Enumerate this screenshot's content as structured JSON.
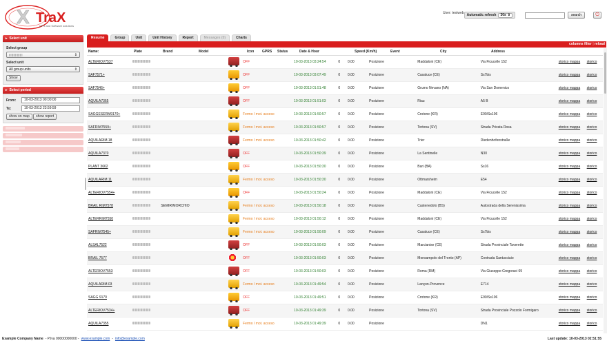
{
  "header": {
    "brand": "TraX",
    "tagline": "GPS and Software solutions",
    "user_label": "User: testweb",
    "auto_refresh_label": "Automatic refresh",
    "auto_refresh_value": "30s",
    "search_value": "",
    "search_button": "search"
  },
  "sidebar": {
    "select_unit_title": "Select unit",
    "select_group_label": "Select group",
    "select_unit_label": "Select unit",
    "unit_value": "All group units",
    "show_button": "Show",
    "select_period_title": "Select period",
    "from_label": "From:",
    "from_value": "10-03-2013 00:00:00",
    "to_label": "To:",
    "to_value": "10-03-2013 23:59:59",
    "show_on_map_button": "show on map",
    "show_report_button": "show report"
  },
  "tabs": [
    {
      "label": "Resume",
      "state": "active"
    },
    {
      "label": "Group",
      "state": "normal"
    },
    {
      "label": "Unit",
      "state": "normal"
    },
    {
      "label": "Unit History",
      "state": "normal"
    },
    {
      "label": "Report",
      "state": "normal"
    },
    {
      "label": "Messages (0)",
      "state": "disabled"
    },
    {
      "label": "Charts",
      "state": "normal"
    }
  ],
  "tab_bar": {
    "columns_filter": "columns filter",
    "reload": "reload"
  },
  "table": {
    "headers": [
      "Name:",
      "Plate",
      "Brand",
      "Model",
      "",
      "Icon",
      "GPRS",
      "Status",
      "Date & Hour",
      "",
      "Speed (Km/h)",
      "Event",
      "City",
      "Address",
      "",
      ""
    ],
    "link1": "storico mappa",
    "link2": "storico",
    "rows": [
      {
        "name": "ALTERIOV7537",
        "brand": "",
        "icon": "truck",
        "status": "OFF",
        "dt": "10-03-2013 03:24:54",
        "z1": "0",
        "speed": "0.00",
        "event": "Posizione",
        "city": "Maddaloni (CE)",
        "addr": "Via Ficucelle 152"
      },
      {
        "name": "SAF7571+",
        "brand": "",
        "icon": "van",
        "status": "OFF",
        "dt": "10-03-2013 03:07:49",
        "z1": "0",
        "speed": "0.00",
        "event": "Posizione",
        "city": "Casaluce (CE)",
        "addr": "Ss7bis"
      },
      {
        "name": "SAF7546+",
        "brand": "",
        "icon": "van",
        "status": "OFF",
        "dt": "10-03-2013 01:51:48",
        "z1": "0",
        "speed": "0.00",
        "event": "Posizione",
        "city": "Grumo Nevano (NA)",
        "addr": "Via San Domenico"
      },
      {
        "name": "AQUILA7365",
        "brand": "",
        "icon": "truck",
        "status": "OFF",
        "dt": "10-03-2013 01:51:03",
        "z1": "0",
        "speed": "0.00",
        "event": "Posizione",
        "city": "Riau",
        "addr": "A5 B"
      },
      {
        "name": "SAGGESERM9170+",
        "brand": "",
        "icon": "box",
        "status": "Fermo / mot. acceso",
        "dt": "10-03-2013 01:50:57",
        "z1": "0",
        "speed": "0.00",
        "event": "Posizione",
        "city": "Crotone (KR)",
        "addr": "E90/Ss106"
      },
      {
        "name": "SAFRIM7559+",
        "brand": "",
        "icon": "box",
        "status": "Fermo / mot. acceso",
        "dt": "10-03-2013 01:50:57",
        "z1": "0",
        "speed": "0.00",
        "event": "Posizione",
        "city": "Tortona (SV)",
        "addr": "Strada Privata Rosa"
      },
      {
        "name": "AQUILARIM.18",
        "brand": "",
        "icon": "truck",
        "status": "Fermo / mot. acceso",
        "dt": "10-03-2013 01:50:42",
        "z1": "0",
        "speed": "0.00",
        "event": "Posizione",
        "city": "Trier",
        "addr": "Diedenhofenstraße"
      },
      {
        "name": "AQUILA7370",
        "brand": "",
        "icon": "truck",
        "status": "OFF",
        "dt": "10-03-2013 01:50:39",
        "z1": "0",
        "speed": "0.00",
        "event": "Posizione",
        "city": "La Sentinelle",
        "addr": "N30"
      },
      {
        "name": "PLANT 3662",
        "brand": "",
        "icon": "van",
        "status": "OFF",
        "dt": "10-03-2013 01:50:30",
        "z1": "0",
        "speed": "0.00",
        "event": "Posizione",
        "city": "Bari (BA)",
        "addr": "Ss16"
      },
      {
        "name": "AQUILARIM.11",
        "brand": "",
        "icon": "box",
        "status": "Fermo / mot. acceso",
        "dt": "10-03-2013 01:50:30",
        "z1": "0",
        "speed": "0.00",
        "event": "Posizione",
        "city": "Ottmarsheim",
        "addr": "E54"
      },
      {
        "name": "ALTERIOV7554+",
        "brand": "",
        "icon": "van",
        "status": "OFF",
        "dt": "10-03-2013 01:50:24",
        "z1": "0",
        "speed": "0.00",
        "event": "Posizione",
        "city": "Maddaloni (CE)",
        "addr": "Via Ficucelle 152"
      },
      {
        "name": "BRAIL RIM7578",
        "brand": "SEMIRIMORCHIO",
        "icon": "box",
        "status": "Fermo / mot. acceso",
        "dt": "10-03-2013 01:50:18",
        "z1": "0",
        "speed": "0.00",
        "event": "Posizione",
        "city": "Castenedolo (BS)",
        "addr": "Autostrada della Serenissima"
      },
      {
        "name": "ALTERRIM7550",
        "brand": "",
        "icon": "box",
        "status": "Fermo / mot. acceso",
        "dt": "10-03-2013 01:50:12",
        "z1": "0",
        "speed": "0.00",
        "event": "Posizione",
        "city": "Maddaloni (CE)",
        "addr": "Via Ficucelle 152"
      },
      {
        "name": "SAFRIM7545+",
        "brand": "",
        "icon": "box",
        "status": "Fermo / mot. acceso",
        "dt": "10-03-2013 01:50:09",
        "z1": "0",
        "speed": "0.00",
        "event": "Posizione",
        "city": "Casaluce (CE)",
        "addr": "Ss7bis"
      },
      {
        "name": "ALSAL7522",
        "brand": "",
        "icon": "truck",
        "status": "OFF",
        "dt": "10-03-2013 01:50:03",
        "z1": "0",
        "speed": "0.00",
        "event": "Posizione",
        "city": "Marcianise (CE)",
        "addr": "Strada Provinciale Taverette"
      },
      {
        "name": "BRAIL 7577",
        "brand": "",
        "icon": "pin",
        "status": "OFF",
        "dt": "10-03-2013 01:50:03",
        "z1": "0",
        "speed": "0.00",
        "event": "Posizione",
        "city": "Monsampolo del Tronto (AP)",
        "addr": "Contrada Santucciaio"
      },
      {
        "name": "ALTERIOV7553",
        "brand": "",
        "icon": "truck",
        "status": "OFF",
        "dt": "10-03-2013 01:50:03",
        "z1": "0",
        "speed": "0.00",
        "event": "Posizione",
        "city": "Roma (RM)",
        "addr": "Via Giuseppe Gregoraci 69"
      },
      {
        "name": "AQUILARIM.03",
        "brand": "",
        "icon": "box",
        "status": "Fermo / mot. acceso",
        "dt": "10-03-2013 01:49:54",
        "z1": "0",
        "speed": "0.00",
        "event": "Posizione",
        "city": "Lançon-Provence",
        "addr": "E714"
      },
      {
        "name": "SAGG 9170",
        "brand": "",
        "icon": "van",
        "status": "OFF",
        "dt": "10-03-2013 01:49:51",
        "z1": "0",
        "speed": "0.00",
        "event": "Posizione",
        "city": "Crotone (KR)",
        "addr": "E90/Ss106"
      },
      {
        "name": "ALTERIOV7534+",
        "brand": "",
        "icon": "truck",
        "status": "OFF",
        "dt": "10-03-2013 01:49:39",
        "z1": "0",
        "speed": "0.00",
        "event": "Posizione",
        "city": "Tortona (SV)",
        "addr": "Strada Provinciale Pozzolo Formigaro"
      },
      {
        "name": "AQUILA7355",
        "brand": "",
        "icon": "box",
        "status": "Fermo / mot. acceso",
        "dt": "10-03-2013 01:49:39",
        "z1": "0",
        "speed": "0.00",
        "event": "Posizione",
        "city": "",
        "addr": "DN1"
      }
    ]
  },
  "footer": {
    "company": "Example Company Name",
    "vat": "- P.Iva 00000000000 -",
    "site": "www.example.com",
    "email": "info@example.com",
    "last_update": "Last update: 10-03-2013 02:51:55"
  }
}
